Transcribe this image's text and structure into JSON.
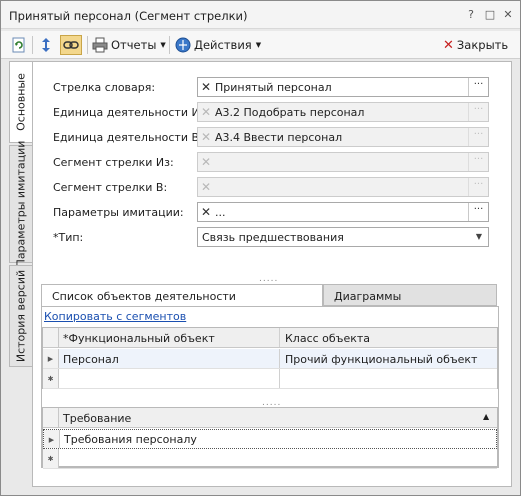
{
  "window": {
    "title": "Принятый персонал (Сегмент стрелки)",
    "help_glyph": "?",
    "restore_glyph": "□",
    "close_glyph": "✕"
  },
  "toolbar": {
    "reports_label": "Отчеты",
    "actions_label": "Действия",
    "close_label": "Закрыть",
    "close_icon_glyph": "✕"
  },
  "side_tabs": [
    {
      "label": "Основные"
    },
    {
      "label": "Параметры имитации"
    },
    {
      "label": "История версий"
    }
  ],
  "form": {
    "fields": [
      {
        "label": "Стрелка словаря:",
        "value": "Принятый персонал",
        "enabled": true
      },
      {
        "label": "Единица деятельности Из:",
        "value": "А3.2 Подобрать персонал",
        "enabled": false
      },
      {
        "label": "Единица деятельности В:",
        "value": "А3.4 Ввести персонал",
        "enabled": false
      },
      {
        "label": "Сегмент стрелки Из:",
        "value": "",
        "enabled": false
      },
      {
        "label": "Сегмент стрелки В:",
        "value": "",
        "enabled": false
      },
      {
        "label": "Параметры имитации:",
        "value": "...",
        "enabled": true
      },
      {
        "label": "*Тип:",
        "value": "Связь предшествования",
        "enabled": true
      }
    ],
    "clear_glyph": "✕",
    "browse_glyph": "···",
    "dropdown_glyph": "▼",
    "splitter_glyph": "....."
  },
  "tabs": [
    {
      "label": "Список объектов деятельности",
      "active": true
    },
    {
      "label": "Диаграммы",
      "active": false
    }
  ],
  "objects_tab": {
    "link_label": "Копировать с сегментов",
    "columns": [
      "*Функциональный объект",
      "Класс объекта"
    ],
    "rows": [
      {
        "functional_object": "Персонал",
        "object_class": "Прочий функциональный объект"
      }
    ],
    "new_row_glyph": "✱",
    "current_row_glyph": "▶"
  },
  "requirements": {
    "column": "Требование",
    "sort_glyph": "▲",
    "rows": [
      {
        "requirement": "Требования персоналу"
      }
    ]
  },
  "colors": {
    "accent_link": "#1a4fb0",
    "window_bg": "#e9e9e9",
    "panel_bg": "#ffffff"
  }
}
